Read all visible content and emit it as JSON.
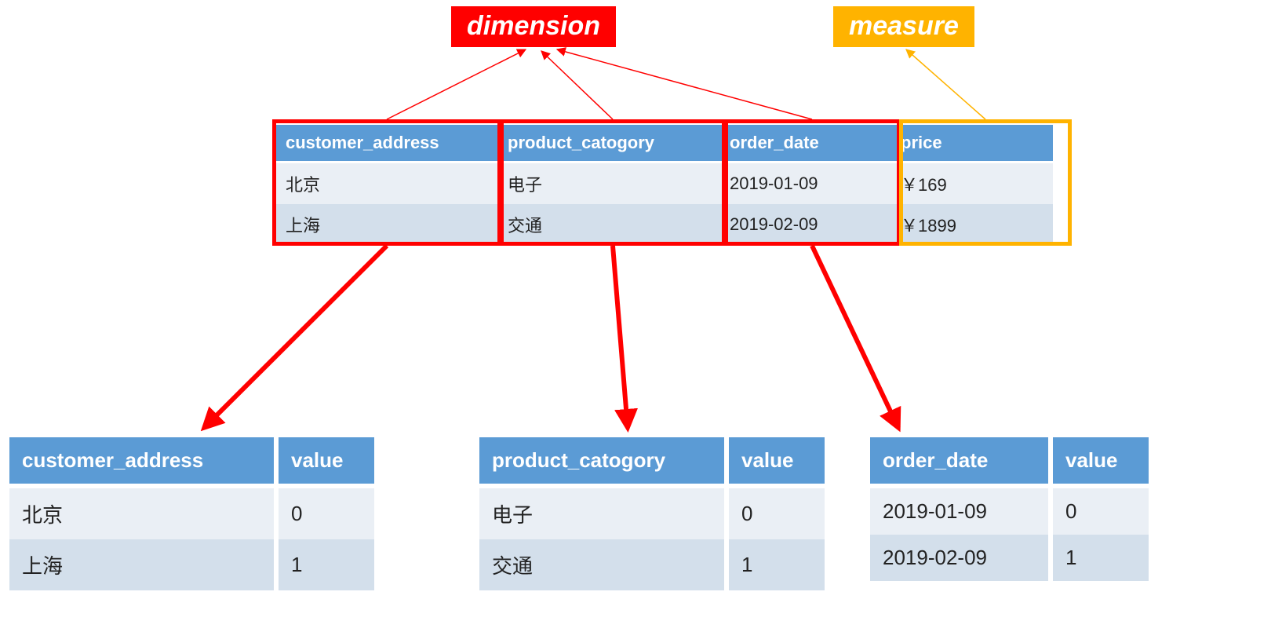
{
  "labels": {
    "dimension": "dimension",
    "measure": "measure"
  },
  "main": {
    "headers": [
      "customer_address",
      "product_catogory",
      "order_date",
      "price"
    ],
    "rows": [
      [
        "北京",
        "电子",
        "2019-01-09",
        "￥169"
      ],
      [
        "上海",
        "交通",
        "2019-02-09",
        "￥1899"
      ]
    ]
  },
  "sub": [
    {
      "headers": [
        "customer_address",
        "value"
      ],
      "rows": [
        [
          "北京",
          "0"
        ],
        [
          "上海",
          "1"
        ]
      ]
    },
    {
      "headers": [
        "product_catogory",
        "value"
      ],
      "rows": [
        [
          "电子",
          "0"
        ],
        [
          "交通",
          "1"
        ]
      ]
    },
    {
      "headers": [
        "order_date",
        "value"
      ],
      "rows": [
        [
          "2019-01-09",
          "0"
        ],
        [
          "2019-02-09",
          "1"
        ]
      ]
    }
  ],
  "colors": {
    "header_bg": "#5b9bd5",
    "row_even": "#eaeff5",
    "row_odd": "#d3dfeb",
    "dimension": "#ff0000",
    "measure": "#ffb300"
  }
}
